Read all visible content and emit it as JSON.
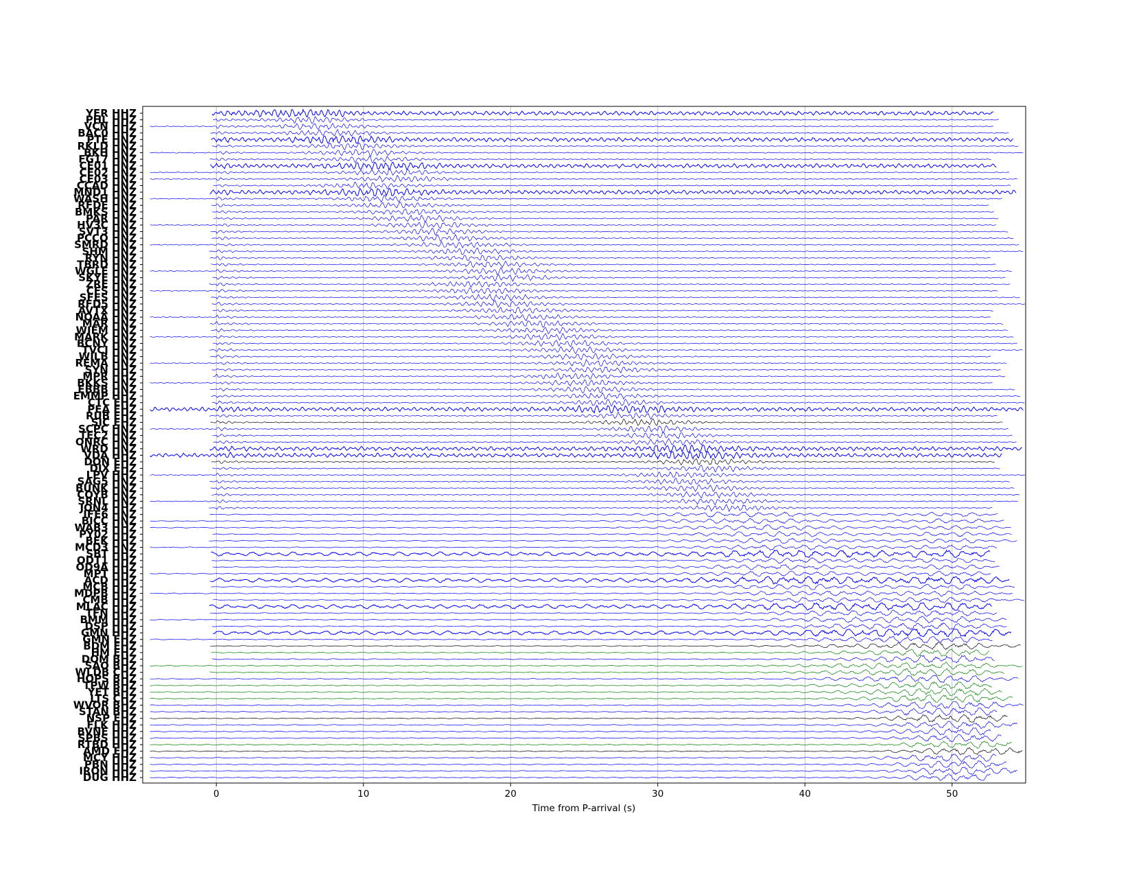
{
  "chart_data": {
    "type": "line",
    "title": "",
    "xlabel": "Time from P-arrival (s)",
    "ylabel": "",
    "xlim": [
      -5,
      55
    ],
    "xticks": [
      0,
      10,
      20,
      30,
      40,
      50
    ],
    "grid": "vertical",
    "legend": "none",
    "colors": {
      "trace_default": "#0000ff",
      "trace_black": "#000000",
      "trace_green": "#008000",
      "grid": "#b0b0c8"
    },
    "stations": [
      "YER HHZ",
      "PHL HHZ",
      "VCN HHZ",
      "BAC0 HHZ",
      "PTE HNZ",
      "RKLD HNZ",
      "BKH HNZ",
      "FG17 HNZ",
      "CE01 HNZ",
      "CE02 HNZ",
      "CE03 HNZ",
      "CCAD HNZ",
      "MND1 HNZ",
      "WASH HNZ",
      "RFDE HNZ",
      "BMKS HNZ",
      "PAR HNZ",
      "HV3C HNZ",
      "SVT3 HNZ",
      "PCCO HNZ",
      "SMRD HNZ",
      "SHM HNZ",
      "RYN HNZ",
      "TBRD HNZ",
      "WGLE HNZ",
      "SKYE HNZ",
      "ZRE HNZ",
      "CFS HNZ",
      "SFES HNZ",
      "RFD5 HNZ",
      "AVTX HNZ",
      "NOAA HNZ",
      "MAR HNZ",
      "WIEM HNZ",
      "MARK HNZ",
      "BCNY HNZ",
      "TVCI HNZ",
      "WILB HNZ",
      "REMA HNZ",
      "SYN HHZ",
      "MPR HHZ",
      "BKKS HNZ",
      "EBBB HNZ",
      "EMMP HHZ",
      "CTC EHZ",
      "PEA EHZ",
      "RUB EHZ",
      "SIC EHZ",
      "SCPC HNZ",
      "TEC2 HNZ",
      "ONRC HNZ",
      "WRD HNZ",
      "VDA HHZ",
      "DON EHZ",
      "DIX EHZ",
      "LPV HHZ",
      "SAG5 HNZ",
      "BUNK HNZ",
      "COYB HNZ",
      "SRNL HNZ",
      "JON4 HHZ",
      "IFE6 HNZ",
      "BICC HNZ",
      "WAB3 HHZ",
      "PY02 HHZ",
      "BEK HHZ",
      "MCD3 HNZ",
      "SBT HHZ",
      "ODT1 HHZ",
      "OD9A HHZ",
      "MPT HHZ",
      "ACD HHZ",
      "MCB HHZ",
      "MDPB HHZ",
      "CMB HHZ",
      "MLAC HHZ",
      "TFN HHZ",
      "BMM HHZ",
      "DSP HHZ",
      "GMN HHZ",
      "GMN EHZ",
      "BDM EHZ",
      "HM EHZ",
      "DOM BHZ",
      "SAO BHZ",
      "WLDB CHZ",
      "HOPS BHZ",
      "TPW BHZ",
      "YET BHZ",
      "LTS CHZ",
      "WVOR BHZ",
      "STAN BHZ",
      "NSP EHZ",
      "FLK HHZ",
      "BVNE HHZ",
      "SPBS HHZ",
      "RTBD HHZ",
      "AMD EHZ",
      "MCY HHZ",
      "PBN HHZ",
      "IRON HHZ",
      "DUG HHZ"
    ],
    "black_traces": [
      "SIC EHZ",
      "DON EHZ",
      "BDM EHZ",
      "NSP EHZ",
      "AMD EHZ"
    ],
    "green_traces": [
      "HM EHZ",
      "SAO BHZ",
      "WLDB CHZ",
      "TPW BHZ",
      "YET BHZ",
      "LTS CHZ",
      "RTBD HHZ"
    ]
  }
}
